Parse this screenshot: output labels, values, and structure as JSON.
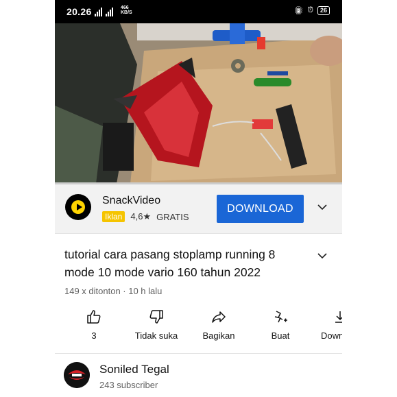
{
  "status_bar": {
    "time": "20.26",
    "net_speed_value": "466",
    "net_speed_unit": "KB/S",
    "battery": "26",
    "icons": [
      "signal-icon",
      "vibrate-icon",
      "alarm-icon",
      "battery-icon"
    ]
  },
  "video": {
    "progress": 0.0
  },
  "ad": {
    "app_name": "SnackVideo",
    "badge": "Iklan",
    "rating": "4,6",
    "rating_icon": "star-icon",
    "price": "GRATIS",
    "button_label": "DOWNLOAD",
    "button_color": "#1a66d6"
  },
  "video_info": {
    "title": "tutorial cara pasang stoplamp running 8 mode 10 mode vario 160 tahun 2022",
    "views": "149 x ditonton · 10 h lalu"
  },
  "actions": [
    {
      "label": "3",
      "icon": "like-icon"
    },
    {
      "label": "Tidak suka",
      "icon": "dislike-icon"
    },
    {
      "label": "Bagikan",
      "icon": "share-icon"
    },
    {
      "label": "Buat",
      "icon": "create-icon"
    },
    {
      "label": "Down",
      "icon": "download-icon"
    }
  ],
  "channel": {
    "name": "Soniled Tegal",
    "subscribers": "243 subscriber"
  }
}
